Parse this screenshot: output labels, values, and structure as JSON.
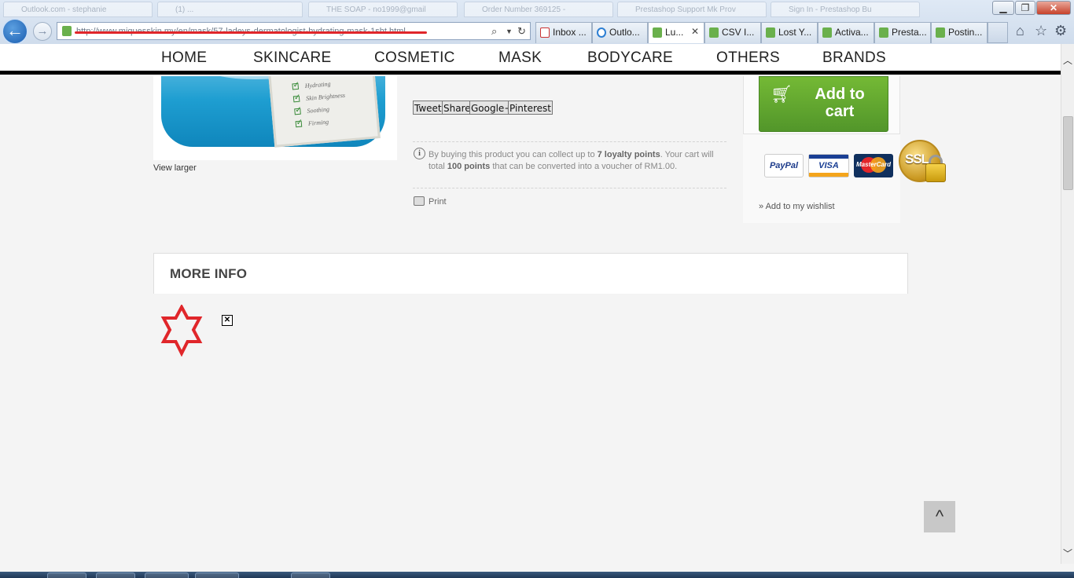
{
  "browser": {
    "address_url": "http://www.miquesskin.my/en/mask/57-ladeys-dermatologist-hydrating-mask-1sht.html",
    "ghost_tabs": [
      "Outlook.com - stephanie",
      "(1) ...",
      "THE SOAP - no1999@gmail",
      "Order Number 369125 -",
      "Prestashop Support Mk Prov",
      "Sign In - Prestashop Bu"
    ],
    "tabs": [
      {
        "label": "Inbox ...",
        "icon": "gmail-icon"
      },
      {
        "label": "Outlo...",
        "icon": "ie-icon"
      },
      {
        "label": "Lu...",
        "icon": "prestashop-icon",
        "active": true
      },
      {
        "label": "CSV I...",
        "icon": "prestashop-icon"
      },
      {
        "label": "Lost Y...",
        "icon": "prestashop-icon"
      },
      {
        "label": "Activa...",
        "icon": "prestashop-icon"
      },
      {
        "label": "Presta...",
        "icon": "prestashop-icon"
      },
      {
        "label": "Postin...",
        "icon": "prestashop-icon"
      }
    ],
    "tab_close": "✕",
    "window_min": "▁",
    "window_max": "❐",
    "window_close": "✕",
    "back_glyph": "←",
    "forward_glyph": "→",
    "home_glyph": "⌂",
    "favorites_glyph": "☆",
    "tools_glyph": "⚙"
  },
  "nav": [
    "HOME",
    "SKINCARE",
    "COSMETIC",
    "MASK",
    "BODYCARE",
    "OTHERS",
    "BRANDS"
  ],
  "product": {
    "checklist": [
      "Hydrating",
      "Skin Brightness",
      "Soothing",
      "Firming"
    ],
    "view_larger": "View larger",
    "share": [
      "Tweet",
      "Share",
      "Google+",
      "Pinterest"
    ],
    "loyalty_prefix": "By buying this product you can collect up to ",
    "loyalty_points": "7 loyalty points",
    "loyalty_mid": ". Your cart will total ",
    "loyalty_total": "100 points",
    "loyalty_suffix": " that can be converted into a voucher of RM1.00.",
    "print": "Print"
  },
  "cart": {
    "add_to_cart": "Add to cart",
    "wishlist": "» Add to my wishlist",
    "payment_badges": [
      "PayPal",
      "VISA",
      "MasterCard",
      "SSL"
    ]
  },
  "more_info": {
    "title": "MORE INFO"
  },
  "back_to_top": "^",
  "colors": {
    "cart_green": "#5ea92c",
    "star_red": "#e0262a",
    "address_strike": "#e0262a",
    "nav_rule": "#000000"
  }
}
